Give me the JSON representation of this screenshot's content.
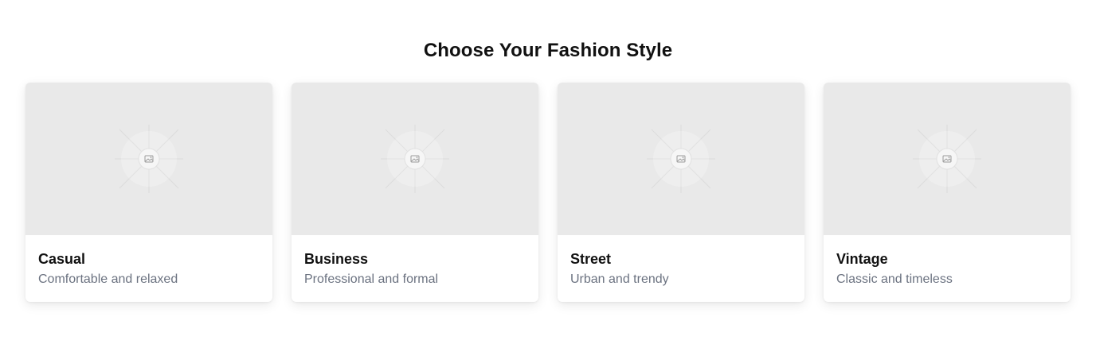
{
  "page": {
    "title": "Choose Your Fashion Style"
  },
  "styles": [
    {
      "name": "Casual",
      "description": "Comfortable and relaxed",
      "icon": "image-placeholder-icon"
    },
    {
      "name": "Business",
      "description": "Professional and formal",
      "icon": "image-placeholder-icon"
    },
    {
      "name": "Street",
      "description": "Urban and trendy",
      "icon": "image-placeholder-icon"
    },
    {
      "name": "Vintage",
      "description": "Classic and timeless",
      "icon": "image-placeholder-icon"
    }
  ],
  "colors": {
    "placeholder_bg": "#e9e9e9",
    "title_text": "#111111",
    "description_text": "#6b7280"
  }
}
